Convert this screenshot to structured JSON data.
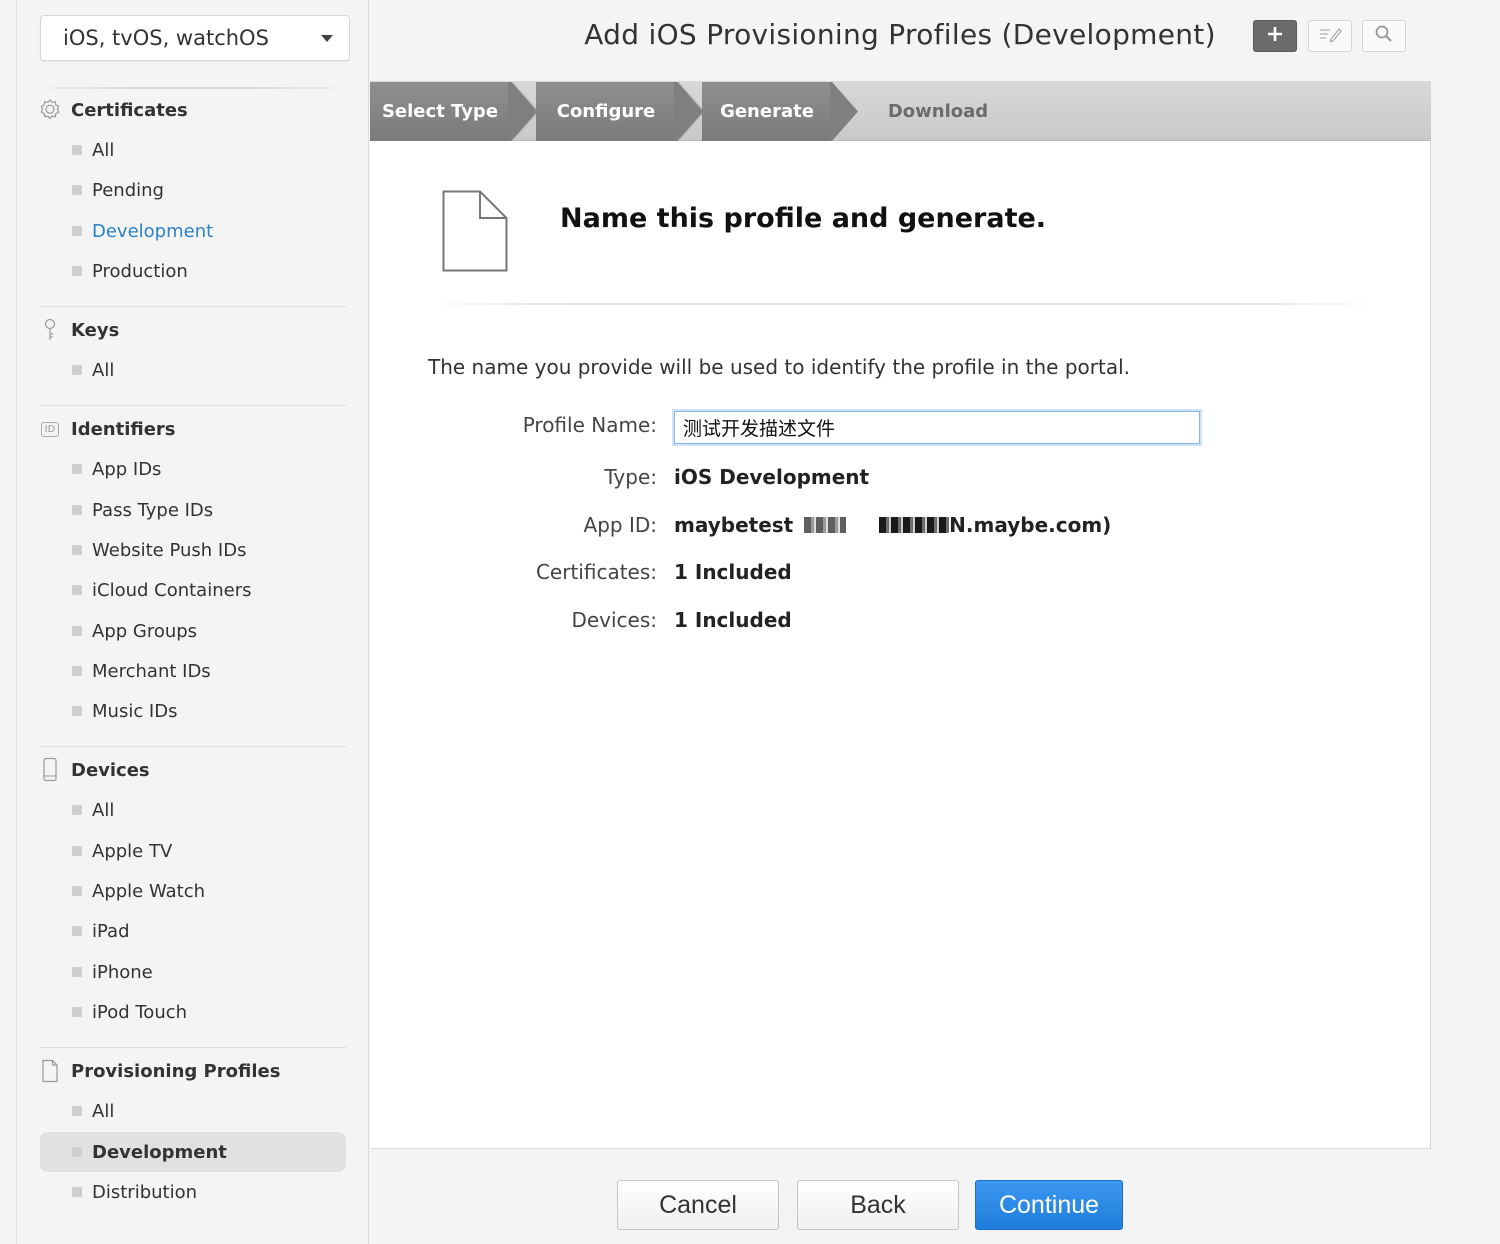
{
  "sidebar": {
    "platform": "iOS, tvOS, watchOS",
    "sections": {
      "certificates": {
        "title": "Certificates",
        "items": [
          "All",
          "Pending",
          "Development",
          "Production"
        ]
      },
      "keys": {
        "title": "Keys",
        "items": [
          "All"
        ]
      },
      "identifiers": {
        "title": "Identifiers",
        "icon_text": "ID",
        "items": [
          "App IDs",
          "Pass Type IDs",
          "Website Push IDs",
          "iCloud Containers",
          "App Groups",
          "Merchant IDs",
          "Music IDs"
        ]
      },
      "devices": {
        "title": "Devices",
        "items": [
          "All",
          "Apple TV",
          "Apple Watch",
          "iPad",
          "iPhone",
          "iPod Touch"
        ]
      },
      "profiles": {
        "title": "Provisioning Profiles",
        "items": [
          "All",
          "Development",
          "Distribution"
        ]
      }
    }
  },
  "header": {
    "title": "Add iOS Provisioning Profiles (Development)",
    "tools": [
      "add-icon",
      "edit-icon",
      "search-icon"
    ]
  },
  "steps": [
    "Select Type",
    "Configure",
    "Generate",
    "Download"
  ],
  "content": {
    "headline": "Name this profile and generate.",
    "description": "The name you provide will be used to identify the profile in the portal.",
    "form": {
      "profile_name_label": "Profile Name:",
      "profile_name_value": "测试开发描述文件",
      "type_label": "Type:",
      "type_value": "iOS Development",
      "app_id_label": "App ID:",
      "app_id_prefix": "maybetest",
      "app_id_suffix": "N.maybe.com)",
      "certificates_label": "Certificates:",
      "certificates_value": "1 Included",
      "devices_label": "Devices:",
      "devices_value": "1 Included"
    }
  },
  "footer": {
    "cancel": "Cancel",
    "back": "Back",
    "continue": "Continue"
  },
  "colors": {
    "link": "#2a82c7",
    "primary": "#2486e6"
  }
}
